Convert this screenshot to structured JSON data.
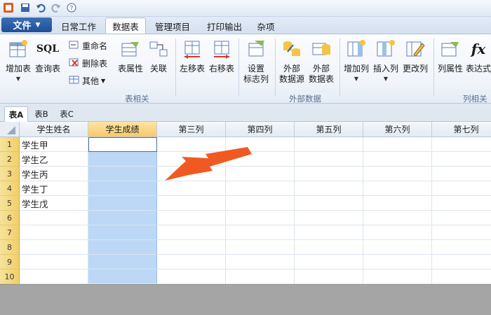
{
  "tabs": {
    "file": "文件",
    "items": [
      "日常工作",
      "数据表",
      "管理项目",
      "打印输出",
      "杂项"
    ],
    "active_index": 1
  },
  "ribbon": {
    "add_table": "增加表",
    "sql_label": "SQL",
    "query_table": "查询表",
    "rename": "重命名",
    "delete_table": "删除表",
    "other": "其他",
    "table_props": "表属性",
    "relation": "关联",
    "move_left": "左移表",
    "move_right": "右移表",
    "set_flag_col": "设置\n标志列",
    "ext_source": "外部\n数据源",
    "ext_table": "外部\n数据表",
    "add_col": "增加列",
    "insert_col": "插入列",
    "change_col": "更改列",
    "col_props": "列属性",
    "fx_label": "fx",
    "expr": "表达式",
    "group_table": "表相关",
    "group_external": "外部数据",
    "group_column": "列相关"
  },
  "sheets": [
    "表A",
    "表B",
    "表C"
  ],
  "grid": {
    "columns": [
      "学生姓名",
      "学生成绩",
      "第三列",
      "第四列",
      "第五列",
      "第六列",
      "第七列"
    ],
    "rows": [
      "1",
      "2",
      "3",
      "4",
      "5",
      "6",
      "7",
      "8",
      "9",
      "10"
    ],
    "names": [
      "学生甲",
      "学生乙",
      "学生丙",
      "学生丁",
      "学生戊"
    ]
  },
  "colors": {
    "accent": "#1d4f96",
    "arrow": "#f05a22",
    "selection": "#bcd8f6",
    "row_header": "#f1cf68"
  },
  "icons": [
    "app-icon",
    "save-icon",
    "undo-icon",
    "redo-icon",
    "help-icon",
    "arrow-pointer-icon"
  ]
}
